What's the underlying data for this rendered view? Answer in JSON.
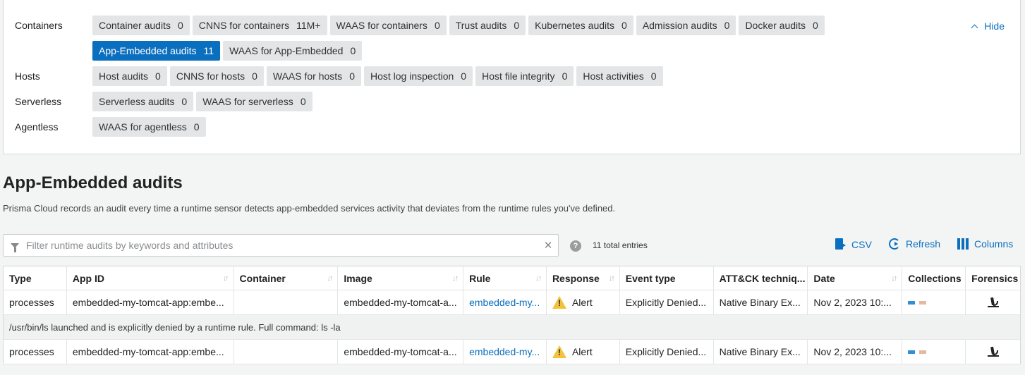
{
  "filters": {
    "hide_label": "Hide",
    "categories": [
      {
        "label": "Containers",
        "rows": [
          [
            {
              "label": "Container audits",
              "count": "0"
            },
            {
              "label": "CNNS for containers",
              "count": "11M+"
            },
            {
              "label": "WAAS for containers",
              "count": "0"
            },
            {
              "label": "Trust audits",
              "count": "0"
            },
            {
              "label": "Kubernetes audits",
              "count": "0"
            },
            {
              "label": "Admission audits",
              "count": "0"
            },
            {
              "label": "Docker audits",
              "count": "0"
            }
          ],
          [
            {
              "label": "App-Embedded audits",
              "count": "11",
              "active": true
            },
            {
              "label": "WAAS for App-Embedded",
              "count": "0"
            }
          ]
        ]
      },
      {
        "label": "Hosts",
        "rows": [
          [
            {
              "label": "Host audits",
              "count": "0"
            },
            {
              "label": "CNNS for hosts",
              "count": "0"
            },
            {
              "label": "WAAS for hosts",
              "count": "0"
            },
            {
              "label": "Host log inspection",
              "count": "0"
            },
            {
              "label": "Host file integrity",
              "count": "0"
            },
            {
              "label": "Host activities",
              "count": "0"
            }
          ]
        ]
      },
      {
        "label": "Serverless",
        "rows": [
          [
            {
              "label": "Serverless audits",
              "count": "0"
            },
            {
              "label": "WAAS for serverless",
              "count": "0"
            }
          ]
        ]
      },
      {
        "label": "Agentless",
        "rows": [
          [
            {
              "label": "WAAS for agentless",
              "count": "0"
            }
          ]
        ]
      }
    ]
  },
  "page": {
    "title": "App-Embedded audits",
    "description": "Prisma Cloud records an audit every time a runtime sensor detects app-embedded services activity that deviates from the runtime rules you've defined."
  },
  "toolbar": {
    "search_placeholder": "Filter runtime audits by keywords and attributes",
    "search_value": "",
    "help_glyph": "?",
    "total_entries": "11 total entries",
    "csv_label": "CSV",
    "refresh_label": "Refresh",
    "columns_label": "Columns"
  },
  "table": {
    "columns": [
      {
        "label": "Type",
        "sortable": false
      },
      {
        "label": "App ID",
        "sortable": true
      },
      {
        "label": "Container",
        "sortable": true
      },
      {
        "label": "Image",
        "sortable": true
      },
      {
        "label": "Rule",
        "sortable": true
      },
      {
        "label": "Response",
        "sortable": true
      },
      {
        "label": "Event type",
        "sortable": false
      },
      {
        "label": "ATT&CK techniq...",
        "sortable": false
      },
      {
        "label": "Date",
        "sortable": true
      },
      {
        "label": "Collections",
        "sortable": false
      },
      {
        "label": "Forensics",
        "sortable": false
      }
    ],
    "rows": [
      {
        "type": "processes",
        "app_id": "embedded-my-tomcat-app:embe...",
        "container": "",
        "image": "embedded-my-tomcat-a...",
        "rule": "embedded-my...",
        "response": "Alert",
        "event_type": "Explicitly Denied...",
        "attack": "Native Binary Ex...",
        "date": "Nov 2, 2023 10:...",
        "detail": "/usr/bin/ls launched and is explicitly denied by a runtime rule. Full command: ls -la"
      },
      {
        "type": "processes",
        "app_id": "embedded-my-tomcat-app:embe...",
        "container": "",
        "image": "embedded-my-tomcat-a...",
        "rule": "embedded-my...",
        "response": "Alert",
        "event_type": "Explicitly Denied...",
        "attack": "Native Binary Ex...",
        "date": "Nov 2, 2023 10:...",
        "detail": ""
      }
    ],
    "collection_colors": [
      "#2f8fd8",
      "#e2b9a5"
    ]
  },
  "colors": {
    "accent": "#0b6fbf",
    "warning": "#f2c23a"
  },
  "icons": {
    "filter": "filter-icon",
    "clear": "close-icon",
    "csv": "export-icon",
    "refresh": "refresh-icon",
    "columns": "columns-icon",
    "warning": "warning-icon",
    "forensics": "microscope-icon",
    "hide": "chevron-up-icon"
  }
}
